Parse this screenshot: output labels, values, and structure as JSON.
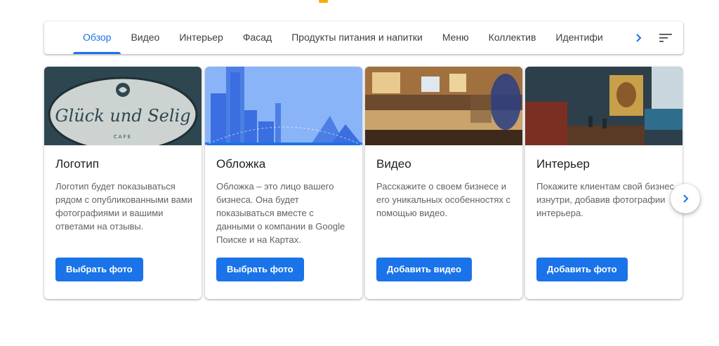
{
  "colors": {
    "accent": "#1a73e8",
    "top_marker": "#f9ab00"
  },
  "tabs": [
    {
      "label": "Обзор",
      "active": true
    },
    {
      "label": "Видео",
      "active": false
    },
    {
      "label": "Интерьер",
      "active": false
    },
    {
      "label": "Фасад",
      "active": false
    },
    {
      "label": "Продукты питания и напитки",
      "active": false
    },
    {
      "label": "Меню",
      "active": false
    },
    {
      "label": "Коллектив",
      "active": false
    },
    {
      "label": "Идентифи",
      "active": false
    }
  ],
  "tab_controls": {
    "next_icon": "chevron-right-icon",
    "filter_icon": "sort-icon"
  },
  "cards": [
    {
      "image": "logo-photo",
      "logo_text": "Glück und Selig",
      "logo_subtext": "CAFE",
      "title": "Логотип",
      "description": "Логотип будет показываться рядом с опубликованными вами фотографиями и вашими ответами на отзывы.",
      "button": "Выбрать фото"
    },
    {
      "image": "cover-illustration",
      "title": "Обложка",
      "description": "Обложка – это лицо вашего бизнеса. Она будет показываться вместе с данными о компании в Google Поиске и на Картах.",
      "button": "Выбрать фото"
    },
    {
      "image": "video-cafe-photo",
      "title": "Видео",
      "description": "Расскажите о своем бизнесе и его уникальных особенностях с помощью видео.",
      "button": "Добавить видео"
    },
    {
      "image": "interior-photo",
      "title": "Интерьер",
      "description": "Покажите клиентам свой бизнес изнутри, добавив фотографии интерьера.",
      "button": "Добавить фото"
    }
  ],
  "carousel_next_icon": "chevron-right-icon"
}
